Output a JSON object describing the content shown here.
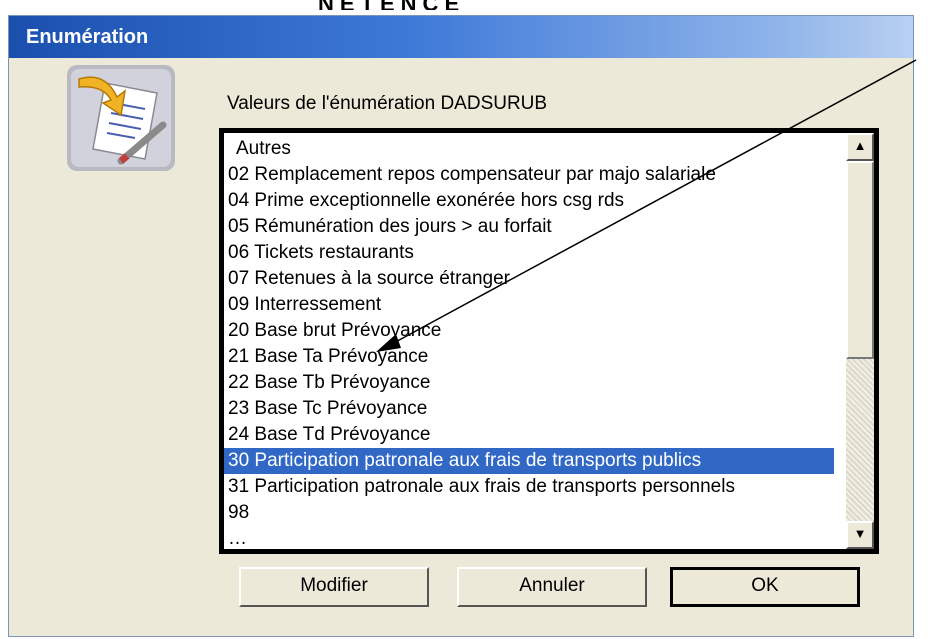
{
  "window": {
    "title": "Enumération"
  },
  "top_fragment": "NETENCE",
  "list": {
    "label": "Valeurs de l'énumération DADSURUB",
    "items": [
      "Autres",
      "02 Remplacement repos compensateur par majo salariale",
      "04 Prime exceptionnelle exonérée hors csg rds",
      "05 Rémunération des jours > au forfait",
      "06 Tickets restaurants",
      "07 Retenues à la source étranger",
      "09 Interressement",
      "20 Base brut Prévoyance",
      "21 Base Ta Prévoyance",
      "22 Base Tb Prévoyance",
      "23 Base Tc Prévoyance",
      "24 Base Td Prévoyance",
      "30 Participation patronale aux frais de transports publics",
      "31 Participation patronale aux frais de transports personnels",
      "98",
      "…"
    ],
    "selected_index": 12
  },
  "scrollbar": {
    "up": "▲",
    "down": "▼"
  },
  "buttons": {
    "modify": "Modifier",
    "cancel": "Annuler",
    "ok": "OK"
  },
  "colors": {
    "selection": "#3168c5",
    "title_bar": "#1a4fae",
    "dialog_bg": "#ece9d8"
  },
  "icons": {
    "app": "document-list-pencil-icon"
  }
}
